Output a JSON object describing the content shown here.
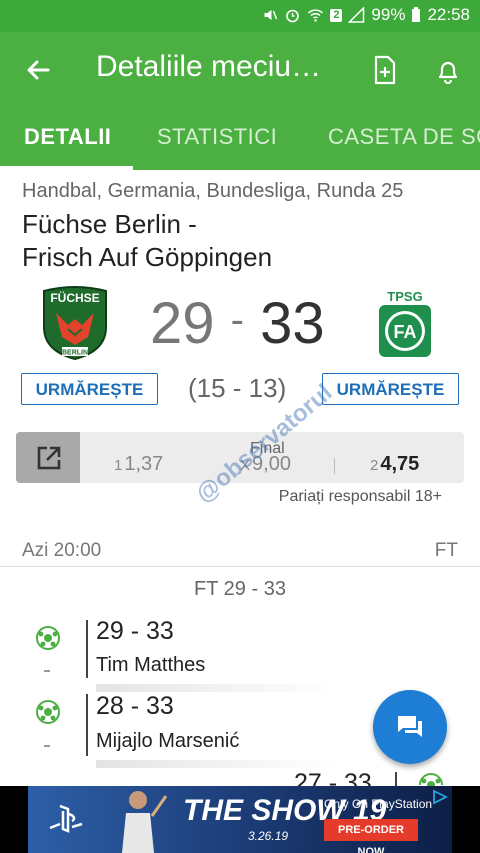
{
  "status_bar": {
    "battery_percent": "99%",
    "time": "22:58",
    "sim_badge": "2"
  },
  "app_bar": {
    "title": "Detaliile meciu…"
  },
  "tabs": [
    {
      "label": "DETALII",
      "active": true
    },
    {
      "label": "STATISTICI",
      "active": false
    },
    {
      "label": "CASETA DE SCOR",
      "active": false
    }
  ],
  "match": {
    "subtitle": "Handbal, Germania, Bundesliga, Runda 25",
    "home_team": "Füchse Berlin -",
    "away_team": "Frisch Auf Göppingen",
    "home_score": "29",
    "score_separator": "-",
    "away_score": "33",
    "halftime": "(15 - 13)",
    "follow_label": "URMĂREȘTE",
    "home_logo_text": "FÜCHSE",
    "home_logo_subtext": "BERLIN",
    "away_logo_text": "TPSG",
    "away_logo_mono": "FA"
  },
  "odds": {
    "label": "Final",
    "items": [
      {
        "key": "1",
        "value": "1,37",
        "best": false
      },
      {
        "key": "X",
        "value": "9,00",
        "best": false
      },
      {
        "key": "2",
        "value": "4,75",
        "best": true
      }
    ],
    "responsible": "Pariați responsabil 18+"
  },
  "info": {
    "datetime": "Azi 20:00",
    "status": "FT"
  },
  "timeline": {
    "ft_label": "FT 29 - 33",
    "events": [
      {
        "score": "29 - 33",
        "player": "Tim Matthes",
        "dash": "-"
      },
      {
        "score": "28 - 33",
        "player": "Mijajlo Marsenić",
        "dash": "-"
      },
      {
        "score": "27 - 33",
        "player": ""
      }
    ]
  },
  "ad": {
    "brand": "THE SHOW 19",
    "release_date": "3.26.19",
    "platform_text": "Only On PlayStation",
    "cta": "PRE-ORDER NOW"
  },
  "watermark": "@observatorul",
  "colors": {
    "primary_green": "#4caf42",
    "status_green": "#3da93a",
    "accent_blue": "#1e6fb8",
    "fab_blue": "#1e7ed6"
  }
}
